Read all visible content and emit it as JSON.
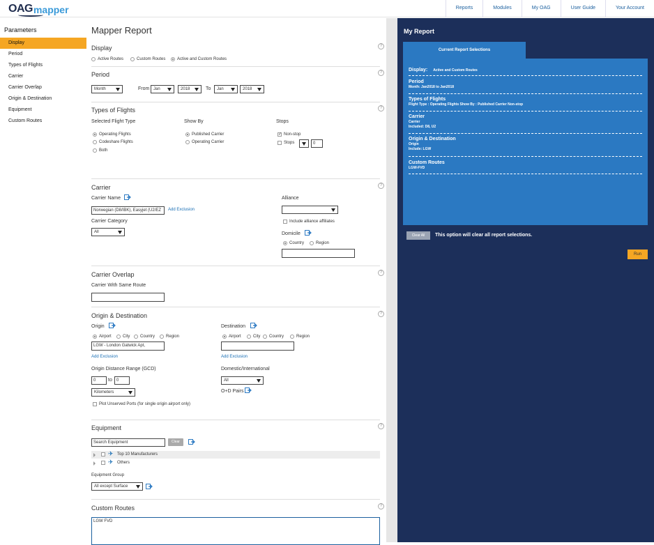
{
  "header": {
    "logo_oag": "OAG",
    "logo_mapper": "mapper",
    "nav": [
      "Reports",
      "Modules",
      "My OAG",
      "User Guide",
      "Your Account"
    ]
  },
  "sidebar": {
    "title": "Parameters",
    "items": [
      "Display",
      "Period",
      "Types of Flights",
      "Carrier",
      "Carrier Overlap",
      "Origin & Destination",
      "Equipment",
      "Custom Routes"
    ],
    "active_index": 0
  },
  "main": {
    "title": "Mapper Report",
    "help_glyph": "?",
    "display": {
      "title": "Display",
      "options": [
        "Active Routes",
        "Custom Routes",
        "Active and Custom Routes"
      ],
      "selected": 2
    },
    "period": {
      "title": "Period",
      "granularity": "Month",
      "from_label": "From",
      "from_month": "Jan",
      "from_year": "2018",
      "to_label": "To",
      "to_month": "Jan",
      "to_year": "2018"
    },
    "types_of_flights": {
      "title": "Types of Flights",
      "selected_label": "Selected Flight Type",
      "flight_types": [
        "Operating Flights",
        "Codeshare Flights",
        "Both"
      ],
      "flight_type_selected": 0,
      "show_by_label": "Show By",
      "show_by": [
        "Published Carrier",
        "Operating Carrier"
      ],
      "show_by_selected": 0,
      "stops_label": "Stops",
      "nonstop": "Non-stop",
      "stops": "Stops",
      "stops_value": "0"
    },
    "carrier": {
      "title": "Carrier",
      "name_label": "Carrier Name",
      "name_value": "Norwegian (D8/IBK), Easyjet (U2/EZ",
      "add_exclusion": "Add Exclusion",
      "category_label": "Carrier Category",
      "category_value": "All",
      "alliance_label": "Alliance",
      "alliance_value": "",
      "include_affiliates": "Include alliance affiliates",
      "domicile_label": "Domicile",
      "domicile_options": [
        "Country",
        "Region"
      ],
      "domicile_selected": 0
    },
    "carrier_overlap": {
      "title": "Carrier Overlap",
      "label": "Carrier With Same Route",
      "value": ""
    },
    "origin_destination": {
      "title": "Origin & Destination",
      "origin_label": "Origin",
      "destination_label": "Destination",
      "types": [
        "Airport",
        "City",
        "Country",
        "Region"
      ],
      "origin_type_selected": 0,
      "destination_type_selected": 0,
      "origin_value": "LGW - London Gatwick Apt,",
      "destination_value": "",
      "add_exclusion": "Add Exclusion",
      "distance_label": "Origin Distance Range (GCD)",
      "distance_from": "0",
      "distance_to_label": "to",
      "distance_to": "0",
      "distance_unit": "Kilometers",
      "plot_unserved": "Plot Unserved Ports (for single origin airport only)",
      "dom_int_label": "Domestic/International",
      "dom_int_value": "All",
      "od_pairs": "O+D Pairs"
    },
    "equipment": {
      "title": "Equipment",
      "search_placeholder": "Search Equipment",
      "clear": "Clear",
      "rows": [
        "Top 10 Manufacturers",
        "Others"
      ],
      "group_label": "Equipment Group",
      "group_value": "All except Surface"
    },
    "custom_routes": {
      "title": "Custom Routes",
      "value": "LGW FVD"
    }
  },
  "report": {
    "title": "My Report",
    "tab": "Current Report Selections",
    "display_label": "Display:",
    "display_value": "Active and Custom Routes",
    "period_label": "Period",
    "period_value": "Month: Jan2018  to Jan2018",
    "types_label": "Types of Flights",
    "types_value": "Flight Type : Operating Flights    Show By : Published Carrier    Non-stop",
    "carrier_label": "Carrier",
    "carrier_sub": "Carrier",
    "carrier_value": "Included: D8, U2",
    "od_label": "Origin & Destination",
    "od_sub": "Origin",
    "od_value": "Include: LGW",
    "custom_label": "Custom Routes",
    "custom_value": "LGW-FVD",
    "clear_btn": "Clear All",
    "clear_text": "This option will clear all report selections.",
    "run": "Run"
  }
}
